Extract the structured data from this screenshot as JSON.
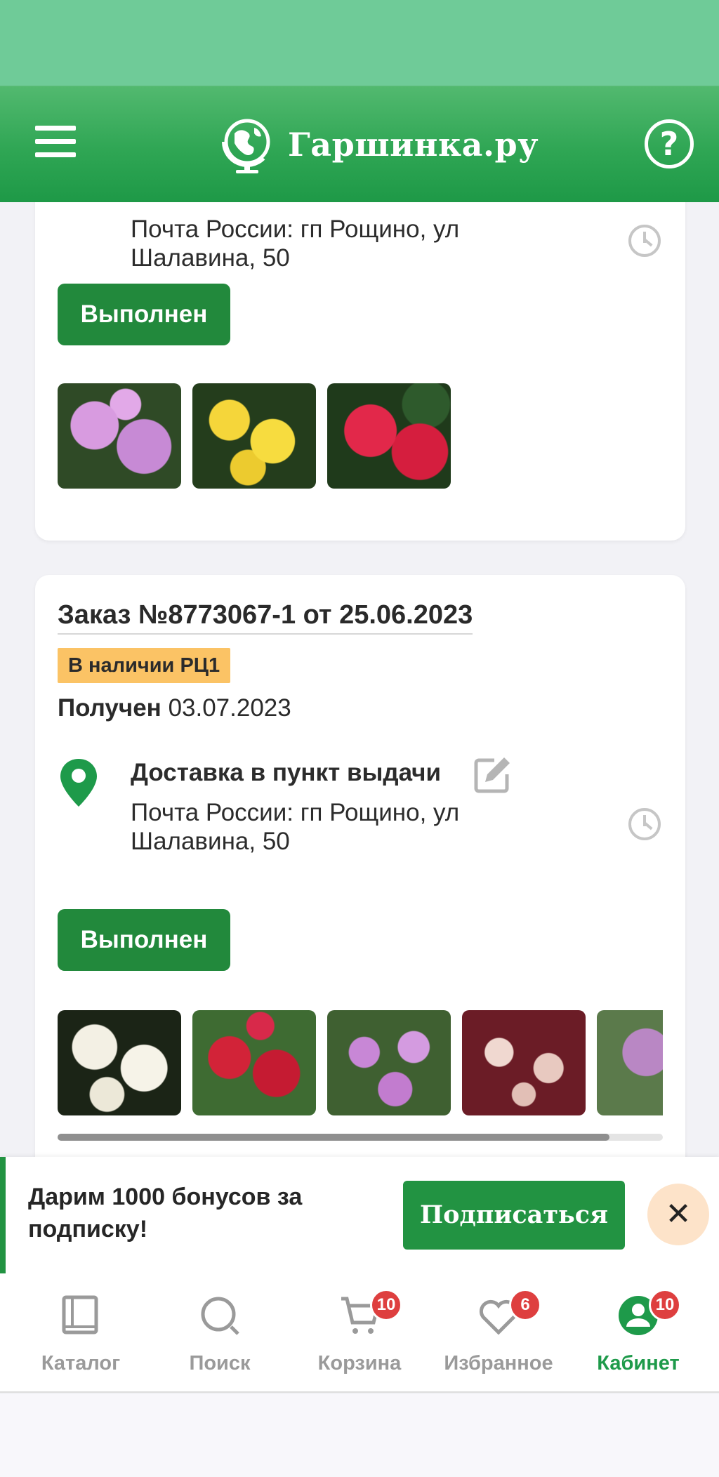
{
  "header": {
    "logo_text": "Гаршинка.ру",
    "help_label": "?"
  },
  "orders": [
    {
      "address": "Почта России: гп Рощино, ул Шалавина, 50",
      "status_button": "Выполнен"
    },
    {
      "title": "Заказ №8773067-1 от 25.06.2023",
      "badge": "В наличии РЦ1",
      "received_label": "Получен",
      "received_date": "03.07.2023",
      "delivery_method": "Доставка в пункт выдачи",
      "address": "Почта России: гп Рощино, ул Шалавина, 50",
      "status_button": "Выполнен"
    }
  ],
  "promo": {
    "text": "Дарим 1000 бонусов за подписку!",
    "subscribe_label": "Подписаться",
    "close_label": "✕"
  },
  "tabbar": {
    "items": [
      {
        "label": "Каталог",
        "icon": "catalog-book-icon",
        "badge": ""
      },
      {
        "label": "Поиск",
        "icon": "search-icon",
        "badge": ""
      },
      {
        "label": "Корзина",
        "icon": "cart-icon",
        "badge": "10"
      },
      {
        "label": "Избранное",
        "icon": "heart-icon",
        "badge": "6"
      },
      {
        "label": "Кабинет",
        "icon": "account-icon",
        "badge": "10",
        "active": true
      }
    ]
  },
  "colors": {
    "brand_green": "#229342",
    "badge_yellow": "#fbc365",
    "badge_red": "#de3f3f",
    "active_tab": "#1e9a4a"
  }
}
